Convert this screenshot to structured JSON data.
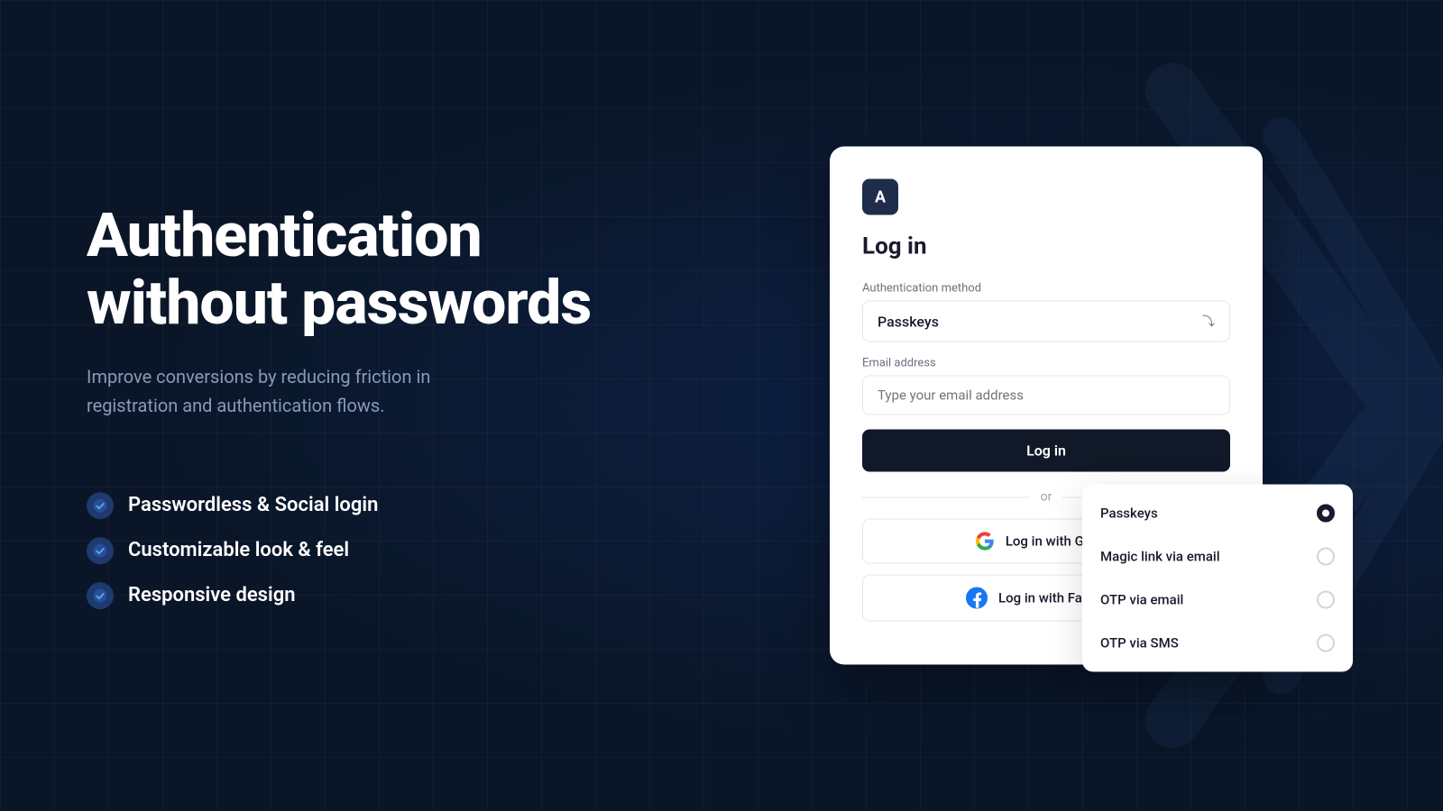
{
  "background": {
    "color": "#0a1628"
  },
  "left": {
    "heading_line1": "Authentication",
    "heading_line2": "without passwords",
    "subheading": "Improve conversions by reducing friction in registration and authentication flows.",
    "features": [
      {
        "id": "feature-1",
        "text": "Passwordless & Social login"
      },
      {
        "id": "feature-2",
        "text": "Customizable look & feel"
      },
      {
        "id": "feature-3",
        "text": "Responsive design"
      }
    ]
  },
  "card": {
    "app_icon_letter": "A",
    "login_title": "Log in",
    "auth_method_label": "Authentication method",
    "auth_method_value": "Passkeys",
    "email_label": "Email address",
    "email_placeholder": "Type your email address",
    "login_button_label": "Log in",
    "divider_text": "or",
    "google_button_label": "Log in with Google",
    "facebook_button_label": "Log in with Facebook"
  },
  "dropdown": {
    "options": [
      {
        "id": "opt-passkeys",
        "label": "Passkeys",
        "selected": true
      },
      {
        "id": "opt-magic-link",
        "label": "Magic link via email",
        "selected": false
      },
      {
        "id": "opt-otp-email",
        "label": "OTP via email",
        "selected": false
      },
      {
        "id": "opt-otp-sms",
        "label": "OTP via SMS",
        "selected": false
      }
    ]
  },
  "icons": {
    "check": "✓",
    "chevron_down": "⌄",
    "google_colors": [
      "#4285F4",
      "#34A853",
      "#FBBC05",
      "#EA4335"
    ],
    "facebook_color": "#1877F2"
  }
}
